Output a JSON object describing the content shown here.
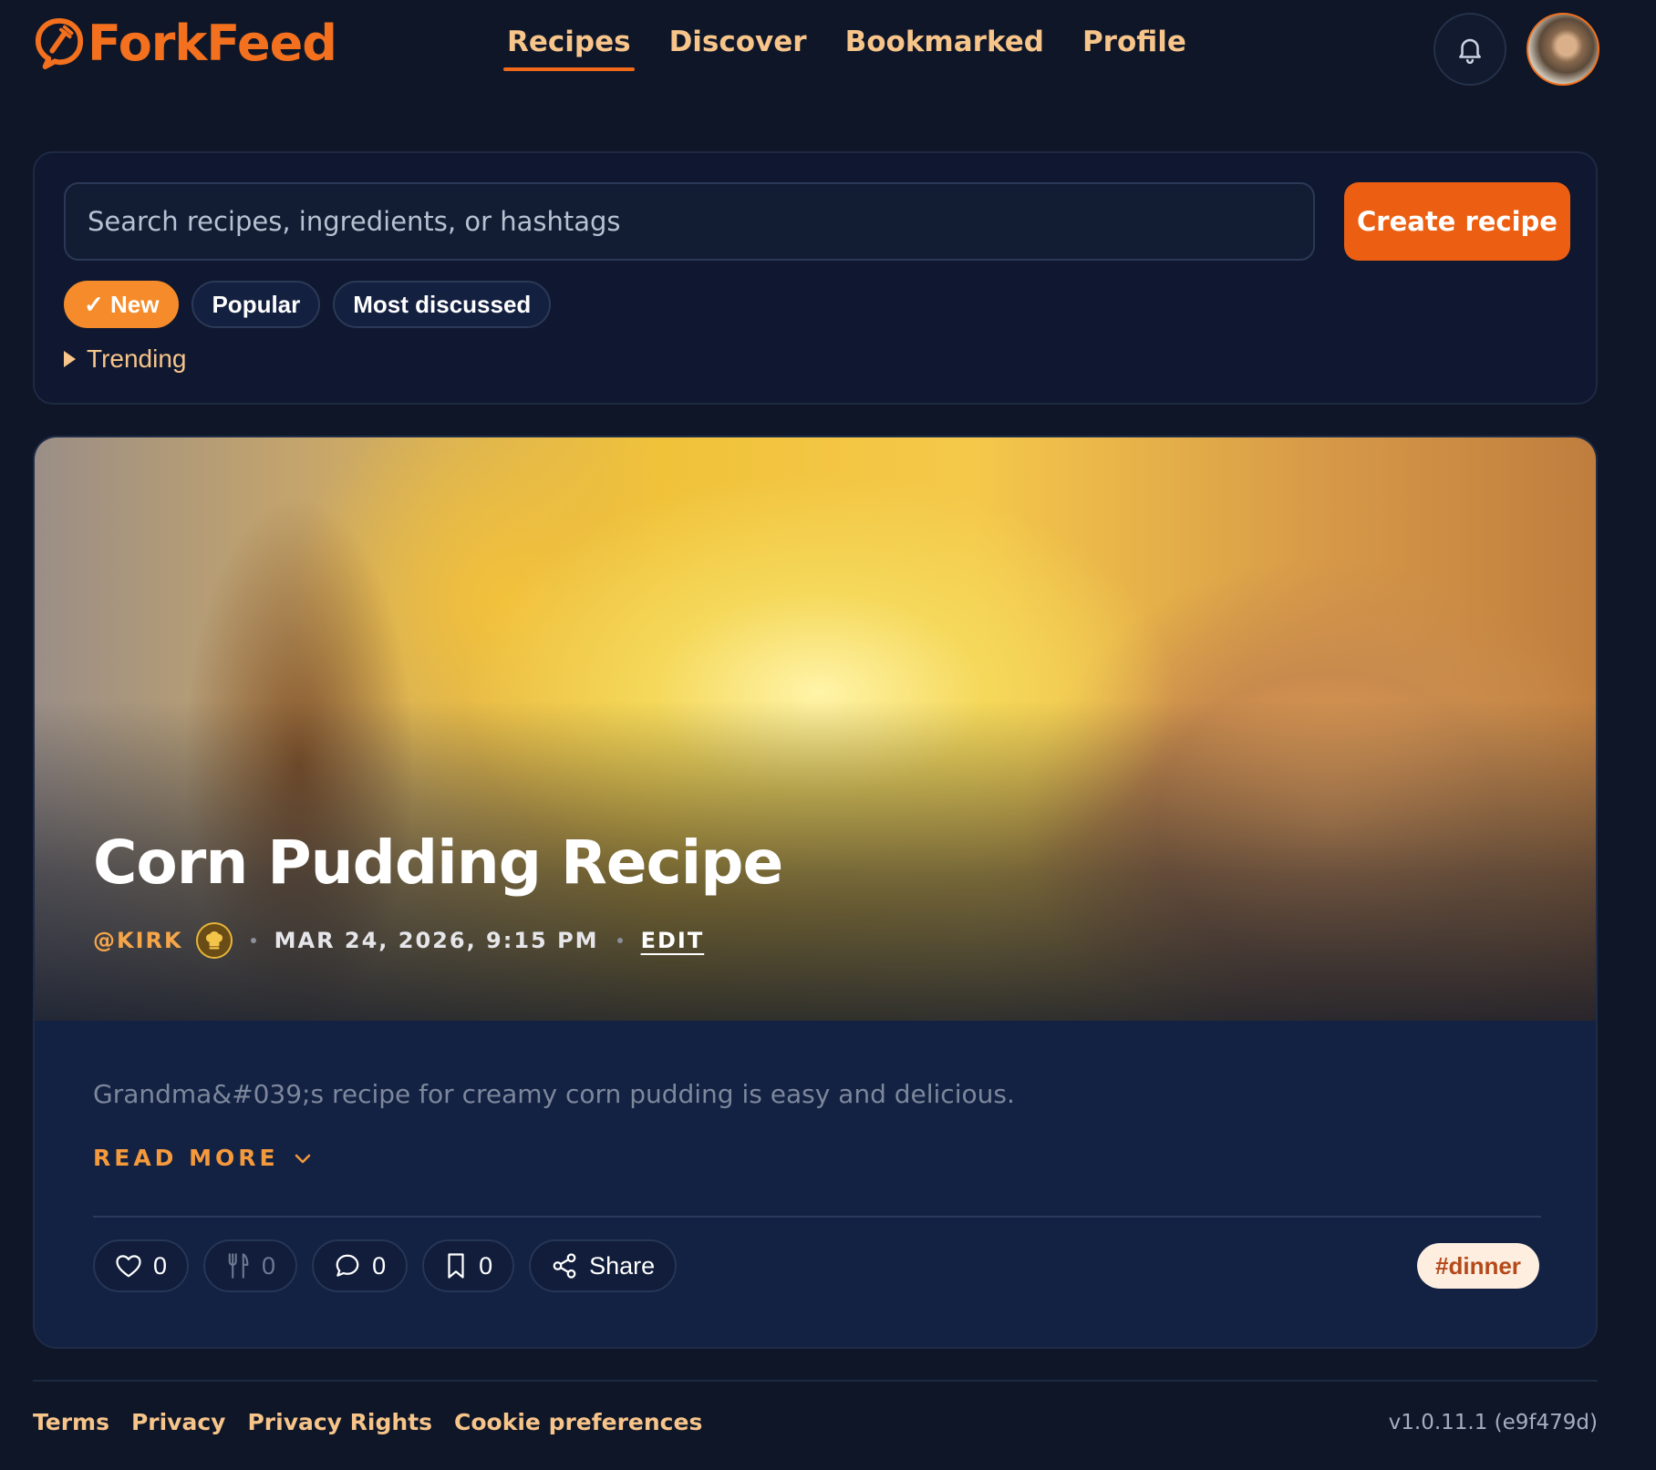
{
  "app": {
    "name": "ForkFeed"
  },
  "nav": {
    "items": [
      {
        "label": "Recipes",
        "active": true
      },
      {
        "label": "Discover",
        "active": false
      },
      {
        "label": "Bookmarked",
        "active": false
      },
      {
        "label": "Profile",
        "active": false
      }
    ]
  },
  "header": {
    "bell_icon": "bell-icon",
    "avatar_icon": "user-avatar"
  },
  "search": {
    "placeholder": "Search recipes, ingredients, or hashtags",
    "value": "",
    "create_label": "Create recipe"
  },
  "filters": {
    "chips": [
      {
        "label": "✓ New",
        "selected": true
      },
      {
        "label": "Popular",
        "selected": false
      },
      {
        "label": "Most discussed",
        "selected": false
      }
    ],
    "trending_label": "Trending"
  },
  "recipe": {
    "title": "Corn Pudding Recipe",
    "author": "@KIRK",
    "date": "MAR 24, 2026, 9:15 PM",
    "edit_label": "EDIT",
    "description": "Grandma&#039;s recipe for creamy corn pudding is easy and delicious.",
    "read_more_label": "READ MORE",
    "likes": "0",
    "cooked": "0",
    "comments": "0",
    "bookmarks": "0",
    "share_label": "Share",
    "tag": "#dinner"
  },
  "footer": {
    "links": [
      "Terms",
      "Privacy",
      "Privacy Rights",
      "Cookie preferences"
    ],
    "version": "v1.0.11.1 (e9f479d)"
  },
  "colors": {
    "background": "#0e1628",
    "accent": "#ec5f12",
    "nav_text": "#f7c48a",
    "card": "#132143"
  }
}
